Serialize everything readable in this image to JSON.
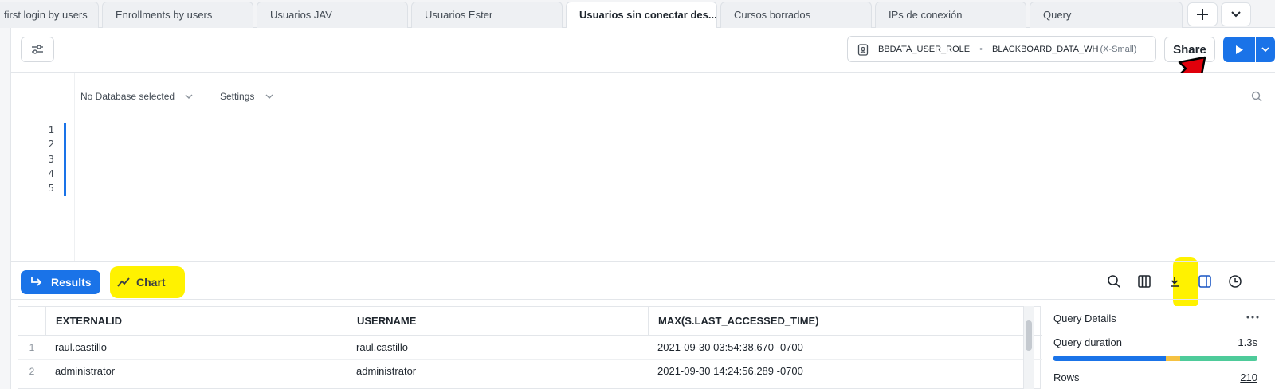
{
  "tabs": [
    {
      "label": "first login by users",
      "active": false
    },
    {
      "label": "Enrollments by users",
      "active": false
    },
    {
      "label": "Usuarios JAV",
      "active": false
    },
    {
      "label": "Usuarios Ester",
      "active": false
    },
    {
      "label": "Usuarios sin conectar des...",
      "active": true
    },
    {
      "label": "Cursos borrados",
      "active": false
    },
    {
      "label": "IPs de conexión",
      "active": false
    },
    {
      "label": "Query",
      "active": false
    }
  ],
  "toolbar": {
    "role": "BBDATA_USER_ROLE",
    "warehouse": "BLACKBOARD_DATA_WH",
    "warehouse_size": "(X-Small)",
    "share_label": "Share"
  },
  "editor": {
    "database_label": "No Database selected",
    "settings_label": "Settings",
    "line_numbers": [
      "1",
      "2",
      "3",
      "4",
      "5"
    ]
  },
  "results": {
    "results_label": "Results",
    "chart_label": "Chart",
    "columns": [
      "EXTERNALID",
      "USERNAME",
      "MAX(S.LAST_ACCESSED_TIME)"
    ],
    "rows": [
      {
        "idx": "1",
        "externalid": "raul.castillo",
        "username": "raul.castillo",
        "max_time": "2021-09-30 03:54:38.670 -0700"
      },
      {
        "idx": "2",
        "externalid": "administrator",
        "username": "administrator",
        "max_time": "2021-09-30 14:24:56.289 -0700"
      }
    ]
  },
  "details": {
    "title": "Query Details",
    "duration_label": "Query duration",
    "duration_value": "1.3s",
    "rows_label": "Rows",
    "rows_value": "210"
  },
  "colors": {
    "accent": "#1a73e8",
    "highlight": "#fff200",
    "annotation_arrow": "#e0000b"
  }
}
